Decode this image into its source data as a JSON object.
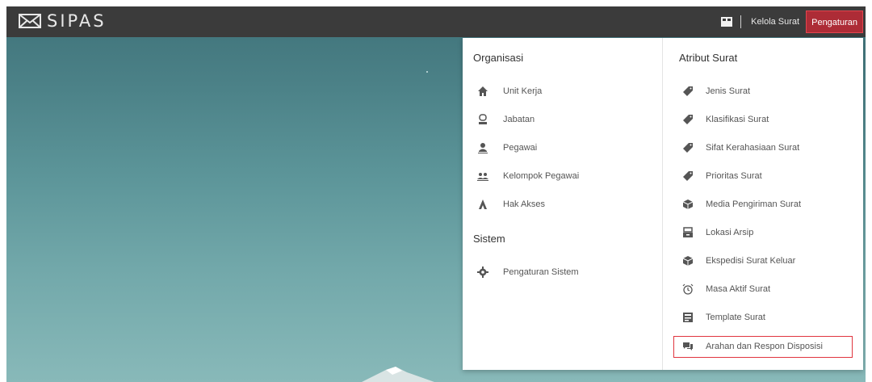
{
  "app": {
    "logo_text": "SIPAS"
  },
  "nav": {
    "kelola_surat": "Kelola Surat",
    "pengaturan": "Pengaturan"
  },
  "menu": {
    "organisasi": {
      "title": "Organisasi",
      "items": [
        {
          "label": "Unit Kerja",
          "icon": "home-icon"
        },
        {
          "label": "Jabatan",
          "icon": "badge-icon"
        },
        {
          "label": "Pegawai",
          "icon": "person-icon"
        },
        {
          "label": "Kelompok Pegawai",
          "icon": "group-icon"
        },
        {
          "label": "Hak Akses",
          "icon": "access-icon"
        }
      ]
    },
    "sistem": {
      "title": "Sistem",
      "items": [
        {
          "label": "Pengaturan Sistem",
          "icon": "gear-icon"
        }
      ]
    },
    "atribut": {
      "title": "Atribut Surat",
      "items": [
        {
          "label": "Jenis Surat",
          "icon": "tag-icon"
        },
        {
          "label": "Klasifikasi Surat",
          "icon": "tag-icon"
        },
        {
          "label": "Sifat Kerahasiaan Surat",
          "icon": "tag-icon"
        },
        {
          "label": "Prioritas Surat",
          "icon": "tag-icon"
        },
        {
          "label": "Media Pengiriman Surat",
          "icon": "cube-icon"
        },
        {
          "label": "Lokasi Arsip",
          "icon": "archive-icon"
        },
        {
          "label": "Ekspedisi Surat Keluar",
          "icon": "cube-icon"
        },
        {
          "label": "Masa Aktif Surat",
          "icon": "alarm-icon"
        },
        {
          "label": "Template Surat",
          "icon": "template-icon"
        },
        {
          "label": "Arahan dan Respon Disposisi",
          "icon": "chat-icon"
        }
      ]
    }
  },
  "colors": {
    "topbar": "#3b3b3b",
    "accent": "#ad2c36",
    "highlight_border": "#e0353f"
  }
}
